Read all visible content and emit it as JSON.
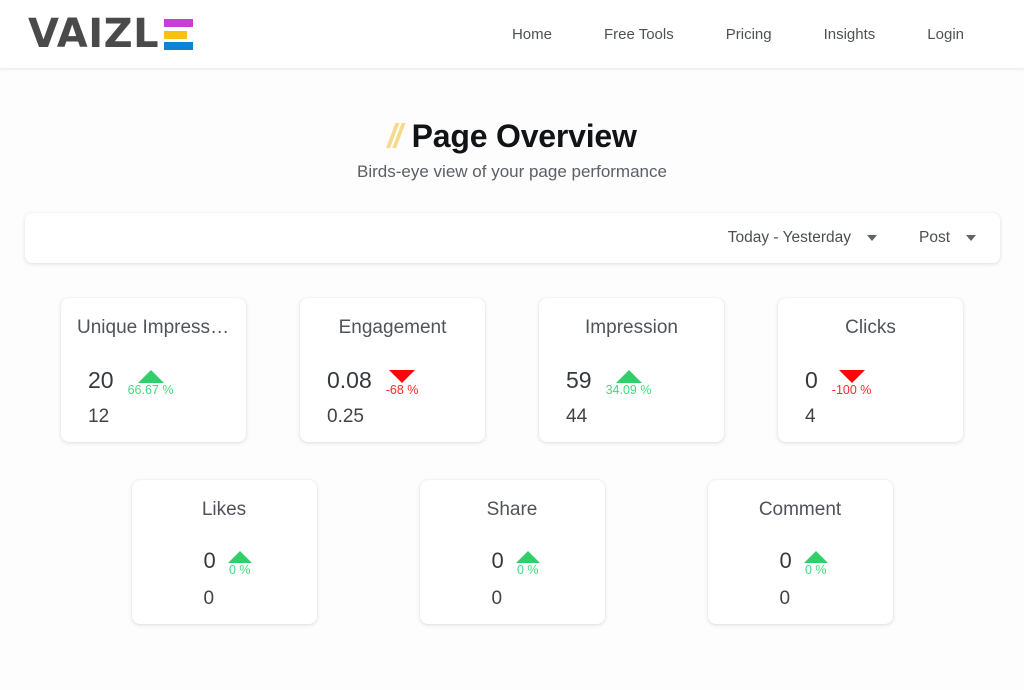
{
  "header": {
    "brand": {
      "word": "VAIZL",
      "e_bar_colors": [
        "#c73dd6",
        "#fcbf15",
        "#0b84d4"
      ]
    },
    "nav": [
      {
        "label": "Home"
      },
      {
        "label": "Free Tools"
      },
      {
        "label": "Pricing"
      },
      {
        "label": "Insights"
      },
      {
        "label": "Login"
      }
    ]
  },
  "hero": {
    "slashes": "//",
    "slashes_color": "#F8D98A",
    "title": "Page Overview",
    "subtitle": "Birds-eye view of your page performance"
  },
  "filters": {
    "date_range": {
      "label": "Today - Yesterday",
      "icon": "chevron-down-icon"
    },
    "content_type": {
      "label": "Post",
      "icon": "chevron-down-icon"
    }
  },
  "colors": {
    "positive": "#3ddc80",
    "negative": "#fb2b2b",
    "text": "#3c4043"
  },
  "metrics_row_1": [
    {
      "title": "Unique Impressi...",
      "value": "20",
      "delta": "66.67 %",
      "direction": "up",
      "previous": "12"
    },
    {
      "title": "Engagement",
      "value": "0.08",
      "delta": "-68 %",
      "direction": "down",
      "previous": "0.25"
    },
    {
      "title": "Impression",
      "value": "59",
      "delta": "34.09 %",
      "direction": "up",
      "previous": "44"
    },
    {
      "title": "Clicks",
      "value": "0",
      "delta": "-100 %",
      "direction": "down",
      "previous": "4"
    }
  ],
  "metrics_row_2": [
    {
      "title": "Likes",
      "value": "0",
      "delta": "0 %",
      "direction": "up",
      "previous": "0"
    },
    {
      "title": "Share",
      "value": "0",
      "delta": "0 %",
      "direction": "up",
      "previous": "0"
    },
    {
      "title": "Comment",
      "value": "0",
      "delta": "0 %",
      "direction": "up",
      "previous": "0"
    }
  ]
}
